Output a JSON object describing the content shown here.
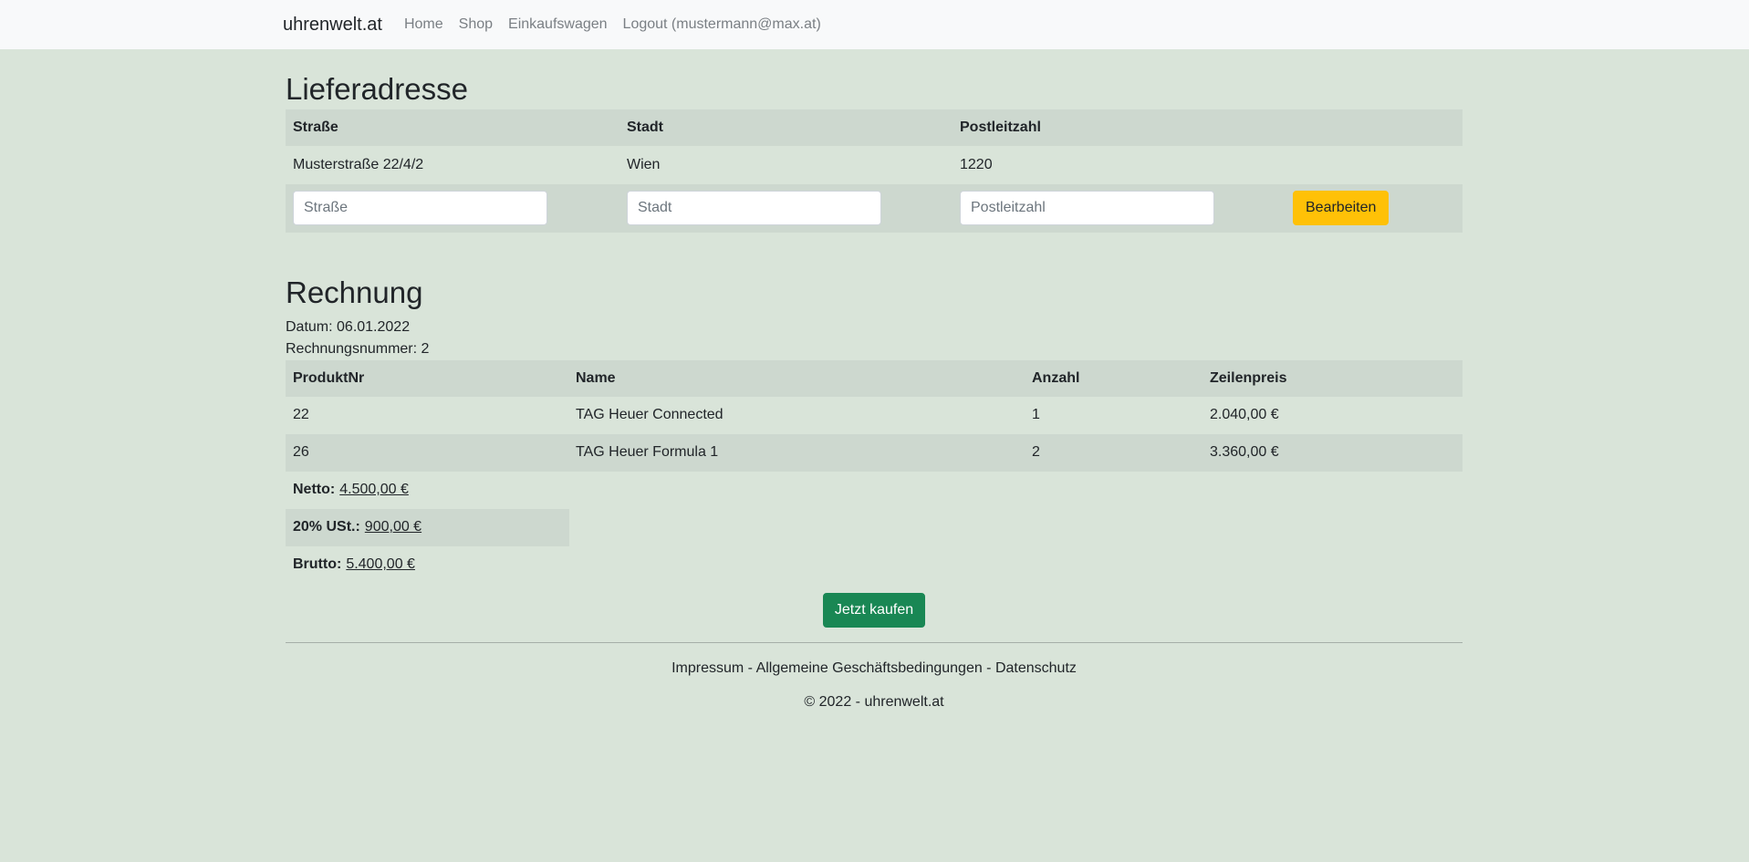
{
  "nav": {
    "brand": "uhrenwelt.at",
    "links": [
      "Home",
      "Shop",
      "Einkaufswagen",
      "Logout (mustermann@max.at)"
    ]
  },
  "address": {
    "title": "Lieferadresse",
    "headers": [
      "Straße",
      "Stadt",
      "Postleitzahl"
    ],
    "row": [
      "Musterstraße 22/4/2",
      "Wien",
      "1220"
    ],
    "placeholders": [
      "Straße",
      "Stadt",
      "Postleitzahl"
    ],
    "edit_label": "Bearbeiten"
  },
  "invoice": {
    "title": "Rechnung",
    "date": "Datum: 06.01.2022",
    "number": "Rechnungsnummer: 2",
    "headers": [
      "ProduktNr",
      "Name",
      "Anzahl",
      "Zeilenpreis"
    ],
    "rows": [
      [
        "22",
        "TAG Heuer Connected",
        "1",
        "2.040,00 €"
      ],
      [
        "26",
        "TAG Heuer Formula 1",
        "2",
        "3.360,00 €"
      ]
    ],
    "net_label": "Netto:",
    "net_value": "4.500,00 €",
    "vat_label": "20% USt.:",
    "vat_value": "900,00 €",
    "gross_label": "Brutto:",
    "gross_value": "5.400,00 €",
    "buy_label": "Jetzt kaufen"
  },
  "footer": {
    "links": [
      "Impressum",
      "Allgemeine Geschäftsbedingungen",
      "Datenschutz"
    ],
    "separator": " - ",
    "copyright": "© 2022 - uhrenwelt.at"
  }
}
